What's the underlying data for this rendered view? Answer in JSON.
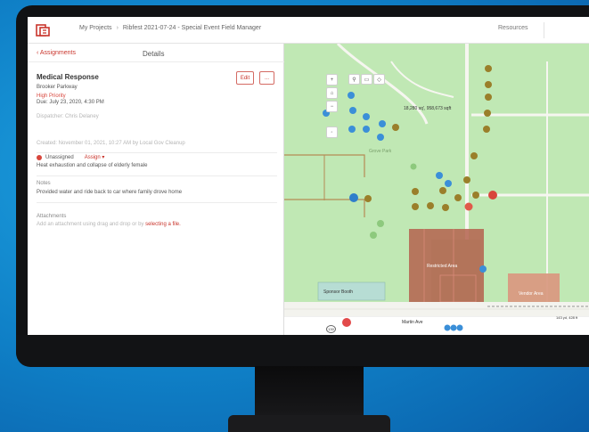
{
  "breadcrumbs": [
    "My Projects",
    "Ribfest 2021-07-24 - Special Event Field Manager"
  ],
  "header": {
    "resources": "Resources"
  },
  "panel": {
    "back_tab": "Assignments",
    "details_tab": "Details",
    "title": "Medical Response",
    "location": "Brooker Parkway",
    "priority": "High Priority",
    "due": "Due: July 23, 2020, 4:30 PM",
    "dispatcher": "Dispatcher: Chris Delaney",
    "status": "Unassigned",
    "assign": "Assign",
    "created": "Created: November 01, 2021, 10:27 AM by Local Gov Cleanup",
    "description": "Heat exhaustion and collapse of elderly female",
    "notes_label": "Notes",
    "notes": "Provided water and ride back to car where family drove home",
    "attachments_label": "Attachments",
    "attachments_hint": "Add an attachment using drag and drop or by",
    "attachments_link": "selecting a file.",
    "edit": "Edit",
    "more": "..."
  },
  "map": {
    "area_label": "18,280 sq', 958,673 sqft",
    "park_label": "Grove Park",
    "sponsor_label": "Sponsor Booth",
    "restricted_label": "Restricted Area",
    "vendor_label": "Vendor Area",
    "street_label": "Martin Ave",
    "measure_label": "143 yd, 428 ft",
    "road_badge": "130"
  },
  "colors": {
    "accent": "#c9352c",
    "map_green": "#bfe7b2",
    "marker_blue": "#3b8fd8",
    "marker_brown": "#9a7f2a",
    "restricted_fill": "#b4624e",
    "vendor_fill": "#d99a82"
  }
}
